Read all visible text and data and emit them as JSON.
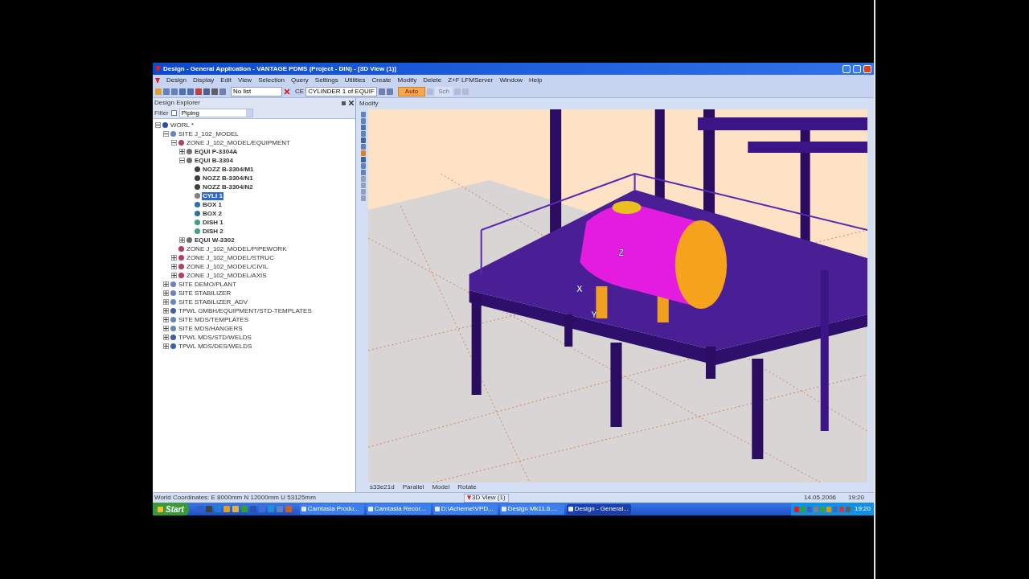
{
  "window": {
    "title": "Design - General Application - VANTAGE PDMS (Project - DIN) - [3D View (1)]"
  },
  "menu": [
    "Design",
    "Display",
    "Edit",
    "View",
    "Selection",
    "Query",
    "Settings",
    "Utilities",
    "Create",
    "Modify",
    "Delete",
    "Z+F LFMServer",
    "Window",
    "Help"
  ],
  "toolbar": {
    "list_combo": "No list",
    "ce_label": "CE",
    "ce_combo": "CYLINDER 1 of EQUIF",
    "auto_button": {
      "label": "Auto",
      "selected": true
    },
    "sch_button": {
      "label": "Sch",
      "disabled": true
    }
  },
  "explorer": {
    "title": "Design Explorer",
    "filter_label": "Filter",
    "filter_checked": false,
    "filter_value": "Piping",
    "tree": [
      {
        "label": "WORL *",
        "kind": "world",
        "expanded": true,
        "selected": false,
        "children": [
          {
            "label": "SITE J_102_MODEL",
            "kind": "site",
            "expanded": true,
            "selected": false,
            "children": [
              {
                "label": "ZONE J_102_MODEL/EQUIPMENT",
                "kind": "zone",
                "expanded": true,
                "selected": false,
                "children": [
                  {
                    "label": "EQUI P-3304A",
                    "kind": "equi",
                    "expanded": false,
                    "selected": false
                  },
                  {
                    "label": "EQUI B-3304",
                    "kind": "equi",
                    "expanded": true,
                    "selected": false,
                    "children": [
                      {
                        "label": "NOZZ B-3304/M1",
                        "kind": "nozz",
                        "selected": false
                      },
                      {
                        "label": "NOZZ B-3304/N1",
                        "kind": "nozz",
                        "selected": false
                      },
                      {
                        "label": "NOZZ B-3304/N2",
                        "kind": "nozz",
                        "selected": false
                      },
                      {
                        "label": "CYLI 1",
                        "kind": "cyli",
                        "selected": true
                      },
                      {
                        "label": "BOX 1",
                        "kind": "box",
                        "selected": false
                      },
                      {
                        "label": "BOX 2",
                        "kind": "box",
                        "selected": false
                      },
                      {
                        "label": "DISH 1",
                        "kind": "dish",
                        "selected": false
                      },
                      {
                        "label": "DISH 2",
                        "kind": "dish",
                        "selected": false
                      }
                    ]
                  },
                  {
                    "label": "EQUI W-3302",
                    "kind": "equi",
                    "expanded": false,
                    "selected": false
                  }
                ]
              },
              {
                "label": "ZONE J_102_MODEL/PIPEWORK",
                "kind": "zone",
                "selected": false
              },
              {
                "label": "ZONE J_102_MODEL/STRUC",
                "kind": "zone",
                "expanded": false,
                "selected": false
              },
              {
                "label": "ZONE J_102_MODEL/CIVIL",
                "kind": "zone",
                "expanded": false,
                "selected": false
              },
              {
                "label": "ZONE J_102_MODEL/AXIS",
                "kind": "zone",
                "expanded": false,
                "selected": false
              }
            ]
          },
          {
            "label": "SITE DEMO/PLANT",
            "kind": "site",
            "expanded": false,
            "selected": false
          },
          {
            "label": "SITE STABILIZER",
            "kind": "site",
            "expanded": false,
            "selected": false
          },
          {
            "label": "SITE STABILIZER_ADV",
            "kind": "site",
            "expanded": false,
            "selected": false
          },
          {
            "label": "TPWL GMBH/EQUIPMENT/STD-TEMPLATES",
            "kind": "tpwl",
            "expanded": false,
            "selected": false
          },
          {
            "label": "SITE MDS/TEMPLATES",
            "kind": "site",
            "expanded": false,
            "selected": false
          },
          {
            "label": "SITE MDS/HANGERS",
            "kind": "site",
            "expanded": false,
            "selected": false
          },
          {
            "label": "TPWL MDS/STD/WELDS",
            "kind": "tpwl",
            "expanded": false,
            "selected": false
          },
          {
            "label": "TPWL MDS/DES/WELDS",
            "kind": "tpwl",
            "expanded": false,
            "selected": false
          }
        ]
      }
    ]
  },
  "view": {
    "title": "Modify",
    "axis_labels": [
      "Z",
      "X",
      "Y"
    ],
    "footer": [
      "s33e21d",
      "Parallel",
      "Model",
      "Rotate"
    ]
  },
  "status_bar": {
    "coordinates": "World Coordinates: E 8000mm N 12000mm U 53125mm",
    "view_tab": "3D View (1)",
    "date": "14.05.2006",
    "time": "19:20"
  },
  "taskbar": {
    "start": "Start",
    "tasks": [
      {
        "label": "Camtasia Produ...",
        "selected": false
      },
      {
        "label": "Camtasia Recor...",
        "selected": false
      },
      {
        "label": "D:\\Acheme\\VPD...",
        "selected": false
      },
      {
        "label": "Design Mk11.6....",
        "selected": false
      },
      {
        "label": "Design - General...",
        "selected": true
      }
    ],
    "clock": "19:20"
  }
}
